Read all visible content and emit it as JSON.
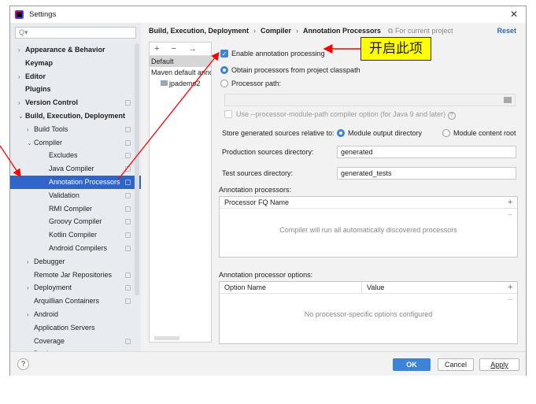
{
  "window": {
    "title": "Settings",
    "close_icon": "close-icon"
  },
  "sidebar": {
    "search_placeholder": "Q▾",
    "items": [
      {
        "label": "Appearance & Behavior",
        "bold": true,
        "arrow": ">",
        "indent": 0
      },
      {
        "label": "Keymap",
        "bold": true,
        "arrow": "",
        "indent": 0
      },
      {
        "label": "Editor",
        "bold": true,
        "arrow": ">",
        "indent": 0
      },
      {
        "label": "Plugins",
        "bold": true,
        "arrow": "",
        "indent": 0
      },
      {
        "label": "Version Control",
        "bold": true,
        "arrow": ">",
        "indent": 0,
        "copy": true
      },
      {
        "label": "Build, Execution, Deployment",
        "bold": true,
        "arrow": "v",
        "indent": 0
      },
      {
        "label": "Build Tools",
        "arrow": ">",
        "indent": 1,
        "copy": true
      },
      {
        "label": "Compiler",
        "arrow": "v",
        "indent": 1,
        "copy": true
      },
      {
        "label": "Excludes",
        "arrow": "",
        "indent": 2,
        "copy": true
      },
      {
        "label": "Java Compiler",
        "arrow": "",
        "indent": 2,
        "copy": true
      },
      {
        "label": "Annotation Processors",
        "arrow": "",
        "indent": 2,
        "copy": true,
        "selected": true
      },
      {
        "label": "Validation",
        "arrow": "",
        "indent": 2,
        "copy": true
      },
      {
        "label": "RMI Compiler",
        "arrow": "",
        "indent": 2,
        "copy": true
      },
      {
        "label": "Groovy Compiler",
        "arrow": "",
        "indent": 2,
        "copy": true
      },
      {
        "label": "Kotlin Compiler",
        "arrow": "",
        "indent": 2,
        "copy": true
      },
      {
        "label": "Android Compilers",
        "arrow": "",
        "indent": 2,
        "copy": true
      },
      {
        "label": "Debugger",
        "arrow": ">",
        "indent": 1
      },
      {
        "label": "Remote Jar Repositories",
        "arrow": "",
        "indent": 1,
        "copy": true
      },
      {
        "label": "Deployment",
        "arrow": ">",
        "indent": 1,
        "copy": true
      },
      {
        "label": "Arquillian Containers",
        "arrow": "",
        "indent": 1,
        "copy": true
      },
      {
        "label": "Android",
        "arrow": ">",
        "indent": 1
      },
      {
        "label": "Application Servers",
        "arrow": "",
        "indent": 1
      },
      {
        "label": "Coverage",
        "arrow": "",
        "indent": 1,
        "copy": true
      },
      {
        "label": "Docker",
        "arrow": ">",
        "indent": 1
      }
    ]
  },
  "breadcrumb": [
    "Build, Execution, Deployment",
    "Compiler",
    "Annotation Processors"
  ],
  "for_current_project": "For current project",
  "reset": "Reset",
  "profiles": {
    "toolbar": "+ − →",
    "items": [
      "Default",
      "Maven default anno",
      "jpademo2"
    ]
  },
  "options": {
    "enable": "Enable annotation processing",
    "enable_checked": true,
    "obtain": "Obtain processors from project classpath",
    "obtain_selected": true,
    "processor_path": "Processor path:",
    "module_path": "Use --processor-module-path compiler option (for Java 9 and later)",
    "store_label": "Store generated sources relative to:",
    "module_output": "Module output directory",
    "module_content": "Module content root",
    "prod_label": "Production sources directory:",
    "prod_value": "generated",
    "test_label": "Test sources directory:",
    "test_value": "generated_tests"
  },
  "processors": {
    "label": "Annotation processors:",
    "column": "Processor FQ Name",
    "empty": "Compiler will run all automatically discovered processors"
  },
  "proc_options": {
    "label": "Annotation processor options:",
    "columns": [
      "Option Name",
      "Value"
    ],
    "empty": "No processor-specific options configured"
  },
  "buttons": {
    "help": "?",
    "ok": "OK",
    "cancel": "Cancel",
    "apply": "Apply"
  },
  "callout": "开启此项",
  "colors": {
    "accent": "#2f65ca",
    "annotation": "#ff0000",
    "callout_bg": "#ffff00"
  }
}
